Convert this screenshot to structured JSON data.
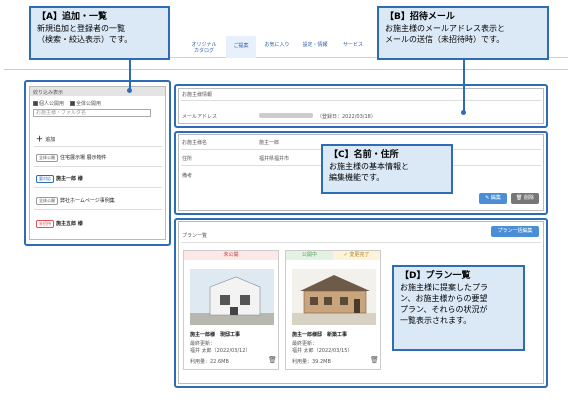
{
  "nav": {
    "items": [
      "オリジナル\nカタログ",
      "ご提案",
      "お気に入り",
      "設定・情報",
      "サービス"
    ],
    "active_index": 1
  },
  "sidebar": {
    "title": "絞り込み表示",
    "filters": [
      "個人公開用",
      "全体公開用"
    ],
    "search_placeholder": "お施主様・フォルダ名",
    "add_label": "追加",
    "items": [
      {
        "badge": "全体公開",
        "name": "住宅展示場 展示物件"
      },
      {
        "badge": "要対応",
        "name": "施主一郎 様"
      },
      {
        "badge": "全体公開",
        "name": "弊社ホームページ事例集"
      },
      {
        "badge": "未招待",
        "name": "施主五郎 様"
      }
    ]
  },
  "owner_info": {
    "title": "お施主様情報",
    "email_label": "メールアドレス",
    "email_value": "（登録日：2022/03/18）"
  },
  "name_section": {
    "rows": [
      {
        "label": "お施主様名",
        "value": "施主一郎"
      },
      {
        "label": "住所",
        "value": "福井県福井市"
      },
      {
        "label": "備考",
        "value": ""
      }
    ],
    "edit_label": "編集",
    "delete_label": "削除"
  },
  "plans": {
    "title": "プラン一覧",
    "new_button": "プラン一括編集",
    "cards": [
      {
        "status": "未公開",
        "title": "施主一郎様　現邸工事",
        "meta1": "最終更新：",
        "meta2": "福井 太郎（2022/03/12）",
        "size": "利用量：22.6MB"
      },
      {
        "status": "公開中",
        "status2": "✓ 変更完了",
        "title": "施主一郎様邸　新築工事",
        "meta1": "最終更新：",
        "meta2": "福井 太郎（2022/03/15）",
        "size": "利用量：39.2MB"
      }
    ]
  },
  "callouts": {
    "a": {
      "title": "【A】追加・一覧",
      "desc": "新規追加と登録者の一覧\n（検索・絞込表示）です。"
    },
    "b": {
      "title": "【B】招待メール",
      "desc": "お施主様のメールアドレス表示と\nメールの送信（未招待時）です。"
    },
    "c": {
      "title": "【C】名前・住所",
      "desc": "お施主様の基本情報と\n編集機能です。"
    },
    "d": {
      "title": "【D】プラン一覧",
      "desc": "お施主様に提案したプラ\nン、お施主様からの要望\nプラン、それらの状況が\n一覧表示されます。"
    }
  },
  "colors": {
    "accent": "#2e6db5",
    "callout_bg": "#dbe9f7",
    "primary_btn": "#4a8fd6",
    "danger": "#e05050",
    "ok": "#5aa05a"
  }
}
